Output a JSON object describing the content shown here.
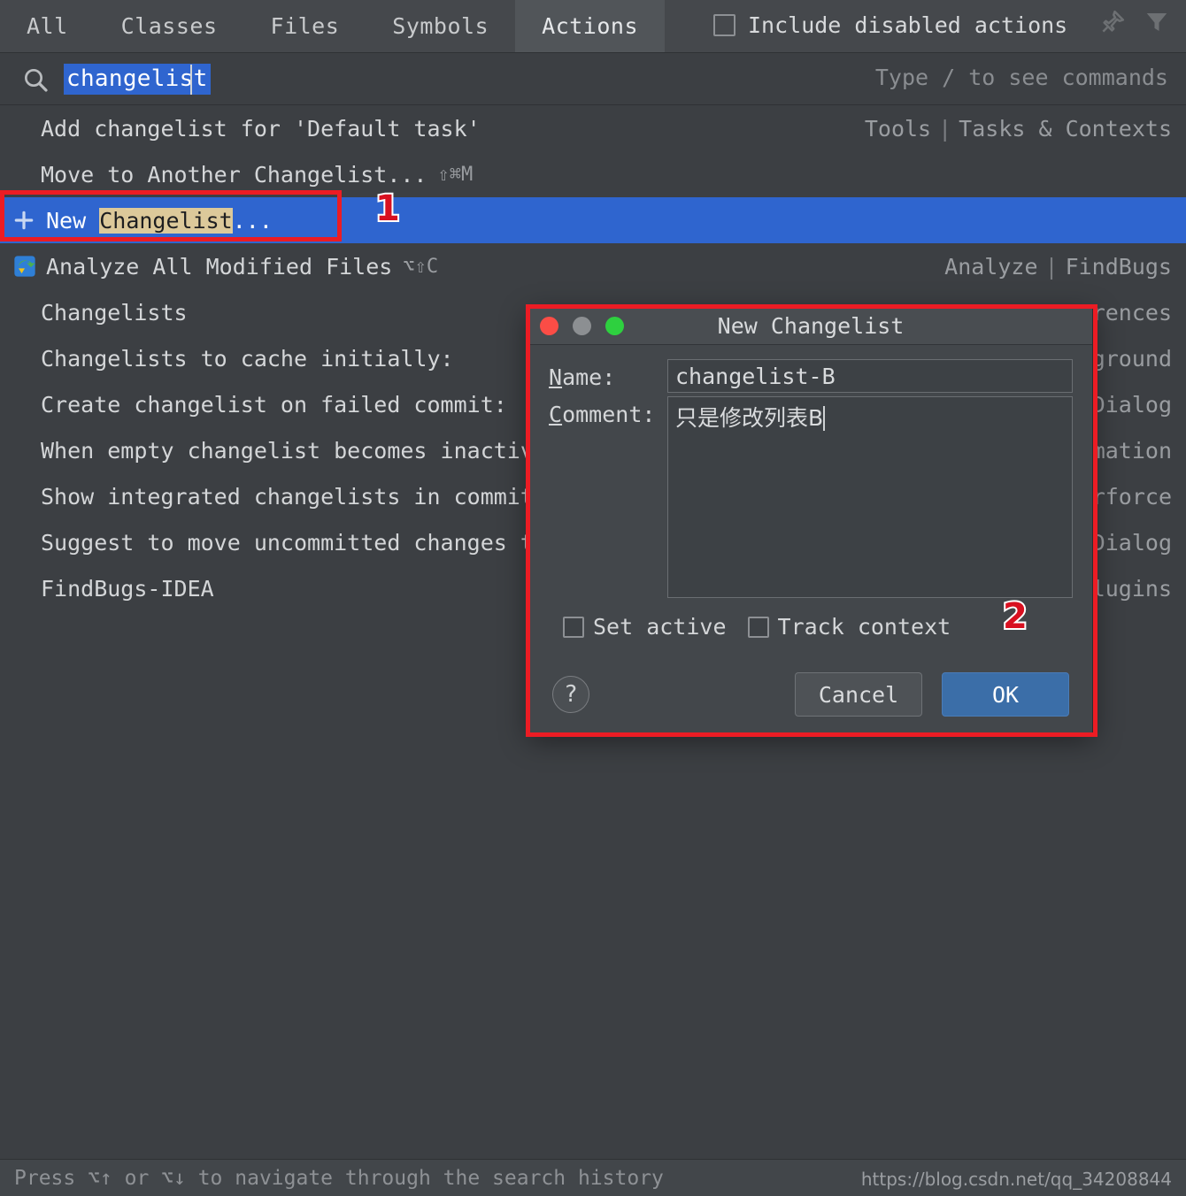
{
  "header": {
    "tabs": [
      {
        "label": "All",
        "active": false
      },
      {
        "label": "Classes",
        "active": false
      },
      {
        "label": "Files",
        "active": false
      },
      {
        "label": "Symbols",
        "active": false
      },
      {
        "label": "Actions",
        "active": true
      }
    ],
    "include_disabled_label": "Include disabled actions",
    "include_disabled_checked": false,
    "pin_icon": "pin-icon",
    "filter_icon": "filter-icon"
  },
  "search": {
    "icon": "search-icon",
    "value": "changelist",
    "placeholder": "Type / to see commands",
    "hint": "Type / to see commands"
  },
  "results": [
    {
      "label": "Add changelist for 'Default task'",
      "shortcut": "",
      "right_primary": "Tools",
      "right_sep": "|",
      "right_secondary": "Tasks & Contexts",
      "selected": false,
      "icon": ""
    },
    {
      "label": "Move to Another Changelist...",
      "shortcut": "⇧⌘M",
      "right_primary": "",
      "right_sep": "",
      "right_secondary": "",
      "selected": false,
      "icon": ""
    },
    {
      "label_pre": "New ",
      "label_hl": "Changelist",
      "label_post": "...",
      "shortcut": "",
      "right_primary": "",
      "right_sep": "",
      "right_secondary": "",
      "selected": true,
      "icon": "plus-icon"
    },
    {
      "label": "Analyze All Modified Files",
      "shortcut": "⌥⇧C",
      "right_primary": "Analyze",
      "right_sep": "|",
      "right_secondary": "FindBugs",
      "selected": false,
      "icon": "inspection-icon"
    }
  ],
  "settings_rows": [
    {
      "label": "Changelists",
      "right": "rences"
    },
    {
      "label": "Changelists to cache initially:",
      "right": "ground"
    },
    {
      "label": "Create changelist on failed commit:",
      "right": "Dialog"
    },
    {
      "label": "When empty changelist becomes inactive",
      "right": "mation"
    },
    {
      "label": "Show integrated changelists in committe",
      "right": "rforce"
    },
    {
      "label": "Suggest to move uncommitted changes to",
      "right": "Dialog"
    },
    {
      "label": "FindBugs-IDEA",
      "right": "lugins"
    }
  ],
  "annotations": [
    {
      "number": "1"
    },
    {
      "number": "2"
    }
  ],
  "dialog": {
    "title": "New Changelist",
    "traffic_lights": [
      "close-button",
      "minimize-button",
      "zoom-button"
    ],
    "name_label": "Name:",
    "name_mnemonic": "N",
    "name_value": "changelist-B",
    "comment_label": "Comment:",
    "comment_mnemonic": "C",
    "comment_value": "只是修改列表B",
    "set_active_label": "Set active",
    "set_active_checked": false,
    "track_context_label": "Track context",
    "track_context_checked": false,
    "help_label": "?",
    "cancel_label": "Cancel",
    "ok_label": "OK"
  },
  "status": {
    "text": "Press ⌥↑ or ⌥↓ to navigate through the search history",
    "watermark": "https://blog.csdn.net/qq_34208844"
  },
  "colors": {
    "background": "#3c3f43",
    "header": "#45484c",
    "active_tab": "#515559",
    "selection_blue": "#2f65cf",
    "match_highlight": "#dcc99a",
    "annotation_red": "#ec1c24",
    "ok_button": "#3b6ea8"
  }
}
